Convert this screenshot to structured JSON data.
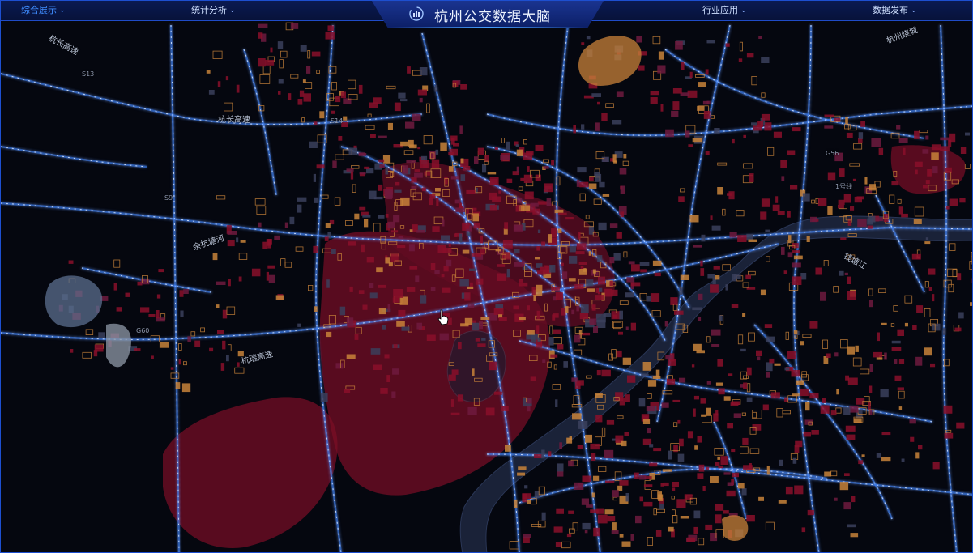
{
  "header": {
    "title": "杭州公交数据大脑",
    "nav_left": [
      {
        "label": "综合展示",
        "active": true
      },
      {
        "label": "统计分析",
        "active": false
      }
    ],
    "nav_right": [
      {
        "label": "行业应用",
        "active": false
      },
      {
        "label": "数据发布",
        "active": false
      }
    ]
  },
  "map": {
    "road_labels": [
      "杭长高速",
      "杭长高速",
      "杭州绕城",
      "余杭塘河",
      "杭瑞高速",
      "钱塘江",
      "1号线",
      "S14",
      "S13",
      "G56",
      "G60",
      "S9"
    ],
    "colors": {
      "background": "#05070f",
      "river": "#1a2238",
      "road_glow": "#3f86ff",
      "district_red": "#8a0f2a",
      "building_orange": "#c8823a",
      "building_gray": "#8f9aa8"
    }
  }
}
